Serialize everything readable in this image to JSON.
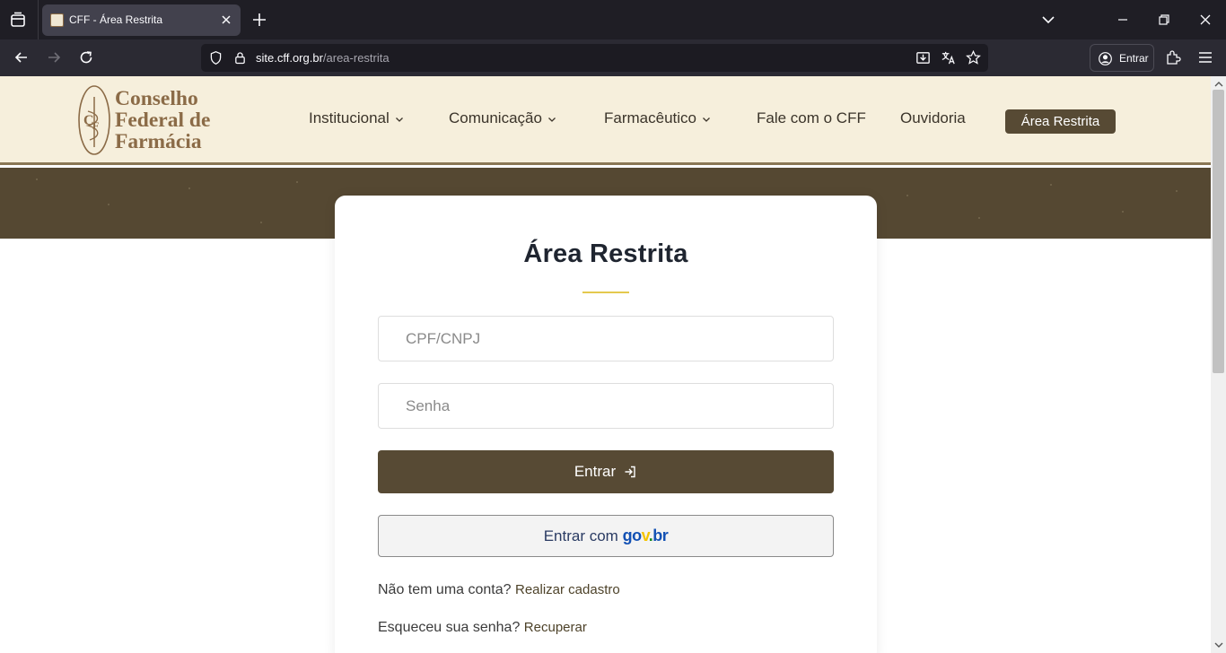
{
  "browser": {
    "tab_title": "CFF - Área Restrita",
    "url_host": "site.cff.org.br",
    "url_path": "/area-restrita",
    "signin_label": "Entrar"
  },
  "header": {
    "logo_lines": [
      "Conselho",
      "Federal de",
      "Farmácia"
    ],
    "menu": [
      {
        "label": "Institucional",
        "has_dropdown": true
      },
      {
        "label": "Comunicação",
        "has_dropdown": true
      },
      {
        "label": "Farmacêutico",
        "has_dropdown": true
      },
      {
        "label": "Fale com o CFF",
        "has_dropdown": false
      },
      {
        "label": "Ouvidoria",
        "has_dropdown": false
      }
    ],
    "cta_label": "Área Restrita"
  },
  "login": {
    "title": "Área Restrita",
    "cpf_placeholder": "CPF/CNPJ",
    "password_placeholder": "Senha",
    "submit_label": "Entrar",
    "gov_prefix": "Entrar com",
    "gov_brand": {
      "part1": "go",
      "part2": "v",
      "part3": ".",
      "part4": "br"
    },
    "no_account_text": "Não tem uma conta?",
    "register_link": "Realizar cadastro",
    "forgot_text": "Esqueceu sua senha?",
    "recover_link": "Recuperar"
  },
  "colors": {
    "brand_brown": "#574a34",
    "header_bg": "#f6efdc",
    "accent_gold": "#e4c94d"
  }
}
